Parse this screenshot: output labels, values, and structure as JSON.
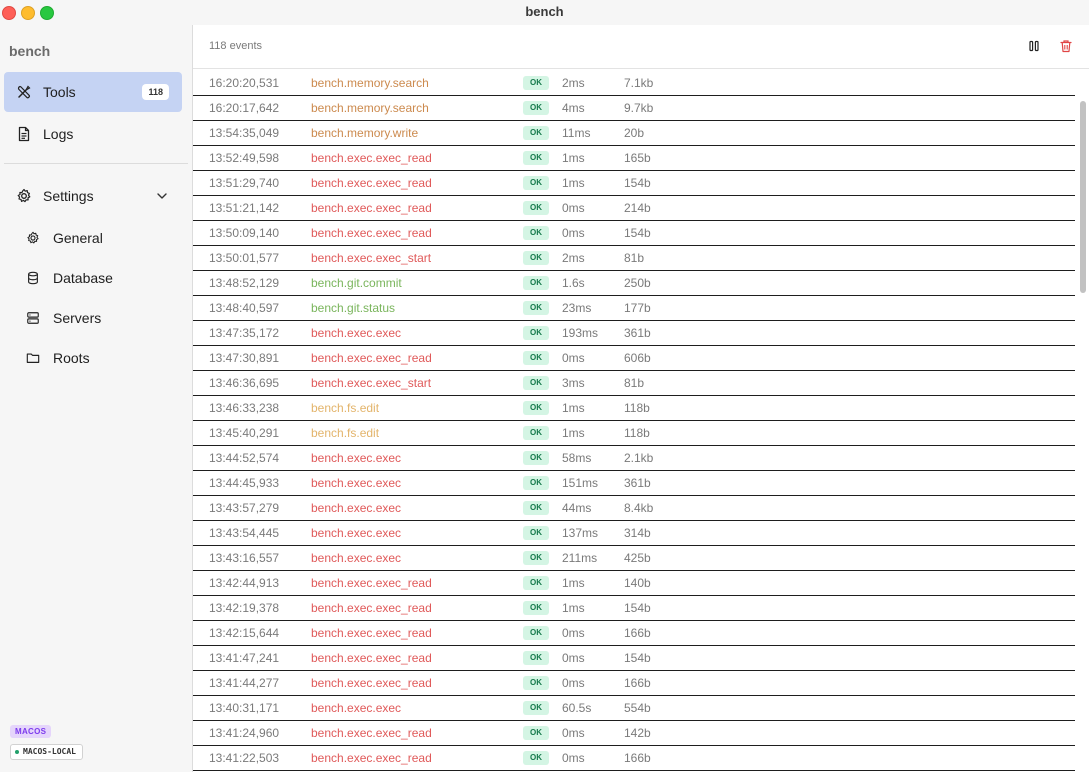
{
  "window": {
    "title": "bench"
  },
  "sidebar": {
    "app_name": "bench",
    "nav": [
      {
        "label": "Tools",
        "count": "118",
        "icon": "tools-icon",
        "active": true
      },
      {
        "label": "Logs",
        "icon": "document-icon"
      }
    ],
    "settings": {
      "label": "Settings",
      "icon": "gear-icon",
      "items": [
        {
          "label": "General",
          "icon": "gear-small-icon"
        },
        {
          "label": "Database",
          "icon": "database-icon"
        },
        {
          "label": "Servers",
          "icon": "server-icon"
        },
        {
          "label": "Roots",
          "icon": "folder-icon"
        }
      ]
    },
    "os_badge": "MACOS",
    "host_badge": "MACOS-LOCAL"
  },
  "main": {
    "event_count": "118 events",
    "colors": {
      "memory": "#cc8a4e",
      "exec": "#e05a5a",
      "git": "#7ab55c",
      "fs": "#e3b46b"
    },
    "events": [
      {
        "time": "16:20:20,531",
        "tool": "bench.memory.search",
        "kind": "memory",
        "status": "OK",
        "duration": "2ms",
        "size": "7.1kb"
      },
      {
        "time": "16:20:17,642",
        "tool": "bench.memory.search",
        "kind": "memory",
        "status": "OK",
        "duration": "4ms",
        "size": "9.7kb"
      },
      {
        "time": "13:54:35,049",
        "tool": "bench.memory.write",
        "kind": "memory",
        "status": "OK",
        "duration": "11ms",
        "size": "20b"
      },
      {
        "time": "13:52:49,598",
        "tool": "bench.exec.exec_read",
        "kind": "exec",
        "status": "OK",
        "duration": "1ms",
        "size": "165b"
      },
      {
        "time": "13:51:29,740",
        "tool": "bench.exec.exec_read",
        "kind": "exec",
        "status": "OK",
        "duration": "1ms",
        "size": "154b"
      },
      {
        "time": "13:51:21,142",
        "tool": "bench.exec.exec_read",
        "kind": "exec",
        "status": "OK",
        "duration": "0ms",
        "size": "214b"
      },
      {
        "time": "13:50:09,140",
        "tool": "bench.exec.exec_read",
        "kind": "exec",
        "status": "OK",
        "duration": "0ms",
        "size": "154b"
      },
      {
        "time": "13:50:01,577",
        "tool": "bench.exec.exec_start",
        "kind": "exec",
        "status": "OK",
        "duration": "2ms",
        "size": "81b"
      },
      {
        "time": "13:48:52,129",
        "tool": "bench.git.commit",
        "kind": "git",
        "status": "OK",
        "duration": "1.6s",
        "size": "250b"
      },
      {
        "time": "13:48:40,597",
        "tool": "bench.git.status",
        "kind": "git",
        "status": "OK",
        "duration": "23ms",
        "size": "177b"
      },
      {
        "time": "13:47:35,172",
        "tool": "bench.exec.exec",
        "kind": "exec",
        "status": "OK",
        "duration": "193ms",
        "size": "361b"
      },
      {
        "time": "13:47:30,891",
        "tool": "bench.exec.exec_read",
        "kind": "exec",
        "status": "OK",
        "duration": "0ms",
        "size": "606b"
      },
      {
        "time": "13:46:36,695",
        "tool": "bench.exec.exec_start",
        "kind": "exec",
        "status": "OK",
        "duration": "3ms",
        "size": "81b"
      },
      {
        "time": "13:46:33,238",
        "tool": "bench.fs.edit",
        "kind": "fs",
        "status": "OK",
        "duration": "1ms",
        "size": "118b"
      },
      {
        "time": "13:45:40,291",
        "tool": "bench.fs.edit",
        "kind": "fs",
        "status": "OK",
        "duration": "1ms",
        "size": "118b"
      },
      {
        "time": "13:44:52,574",
        "tool": "bench.exec.exec",
        "kind": "exec",
        "status": "OK",
        "duration": "58ms",
        "size": "2.1kb"
      },
      {
        "time": "13:44:45,933",
        "tool": "bench.exec.exec",
        "kind": "exec",
        "status": "OK",
        "duration": "151ms",
        "size": "361b"
      },
      {
        "time": "13:43:57,279",
        "tool": "bench.exec.exec",
        "kind": "exec",
        "status": "OK",
        "duration": "44ms",
        "size": "8.4kb"
      },
      {
        "time": "13:43:54,445",
        "tool": "bench.exec.exec",
        "kind": "exec",
        "status": "OK",
        "duration": "137ms",
        "size": "314b"
      },
      {
        "time": "13:43:16,557",
        "tool": "bench.exec.exec",
        "kind": "exec",
        "status": "OK",
        "duration": "211ms",
        "size": "425b"
      },
      {
        "time": "13:42:44,913",
        "tool": "bench.exec.exec_read",
        "kind": "exec",
        "status": "OK",
        "duration": "1ms",
        "size": "140b"
      },
      {
        "time": "13:42:19,378",
        "tool": "bench.exec.exec_read",
        "kind": "exec",
        "status": "OK",
        "duration": "1ms",
        "size": "154b"
      },
      {
        "time": "13:42:15,644",
        "tool": "bench.exec.exec_read",
        "kind": "exec",
        "status": "OK",
        "duration": "0ms",
        "size": "166b"
      },
      {
        "time": "13:41:47,241",
        "tool": "bench.exec.exec_read",
        "kind": "exec",
        "status": "OK",
        "duration": "0ms",
        "size": "154b"
      },
      {
        "time": "13:41:44,277",
        "tool": "bench.exec.exec_read",
        "kind": "exec",
        "status": "OK",
        "duration": "0ms",
        "size": "166b"
      },
      {
        "time": "13:40:31,171",
        "tool": "bench.exec.exec",
        "kind": "exec",
        "status": "OK",
        "duration": "60.5s",
        "size": "554b"
      },
      {
        "time": "13:41:24,960",
        "tool": "bench.exec.exec_read",
        "kind": "exec",
        "status": "OK",
        "duration": "0ms",
        "size": "142b"
      },
      {
        "time": "13:41:22,503",
        "tool": "bench.exec.exec_read",
        "kind": "exec",
        "status": "OK",
        "duration": "0ms",
        "size": "166b"
      }
    ]
  }
}
